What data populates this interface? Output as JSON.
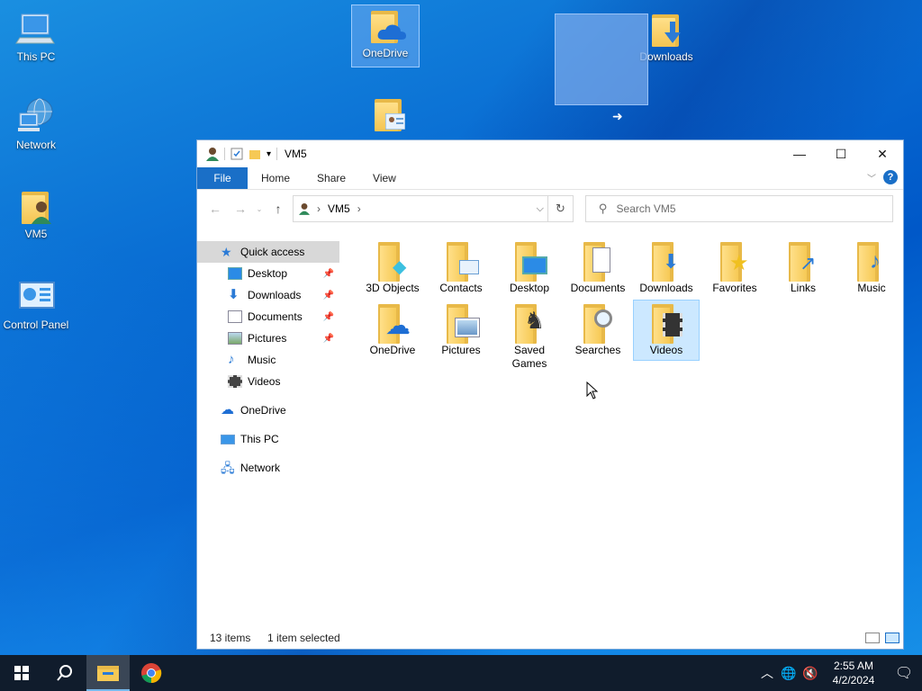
{
  "desktop": {
    "icons": [
      {
        "label": "This PC"
      },
      {
        "label": "Network"
      },
      {
        "label": "VM5"
      },
      {
        "label": "Control Panel"
      },
      {
        "label": "OneDrive"
      },
      {
        "label": "Downloads"
      }
    ]
  },
  "window": {
    "title": "VM5",
    "controls": {
      "minimize": "—",
      "maximize": "☐",
      "close": "✕"
    },
    "ribbon": {
      "tabs": [
        "File",
        "Home",
        "Share",
        "View"
      ],
      "help": "?"
    },
    "address": {
      "crumbs": [
        "VM5"
      ],
      "search_placeholder": "Search VM5"
    },
    "nav_pane": {
      "quick_access": "Quick access",
      "quick_items": [
        {
          "label": "Desktop",
          "pinned": true
        },
        {
          "label": "Downloads",
          "pinned": true
        },
        {
          "label": "Documents",
          "pinned": true
        },
        {
          "label": "Pictures",
          "pinned": true
        },
        {
          "label": "Music",
          "pinned": false
        },
        {
          "label": "Videos",
          "pinned": false
        }
      ],
      "onedrive": "OneDrive",
      "this_pc": "This PC",
      "network": "Network"
    },
    "items": [
      {
        "label": "3D Objects"
      },
      {
        "label": "Contacts"
      },
      {
        "label": "Desktop"
      },
      {
        "label": "Documents"
      },
      {
        "label": "Downloads"
      },
      {
        "label": "Favorites"
      },
      {
        "label": "Links"
      },
      {
        "label": "Music"
      },
      {
        "label": "OneDrive"
      },
      {
        "label": "Pictures"
      },
      {
        "label": "Saved Games"
      },
      {
        "label": "Searches"
      },
      {
        "label": "Videos",
        "selected": true
      }
    ],
    "status": {
      "count": "13 items",
      "selection": "1 item selected"
    }
  },
  "taskbar": {
    "clock_time": "2:55 AM",
    "clock_date": "4/2/2024"
  },
  "colors": {
    "accent": "#1a6fc7",
    "selection": "#cce8ff",
    "folder": "#f6c955",
    "taskbar": "#101c2c"
  }
}
